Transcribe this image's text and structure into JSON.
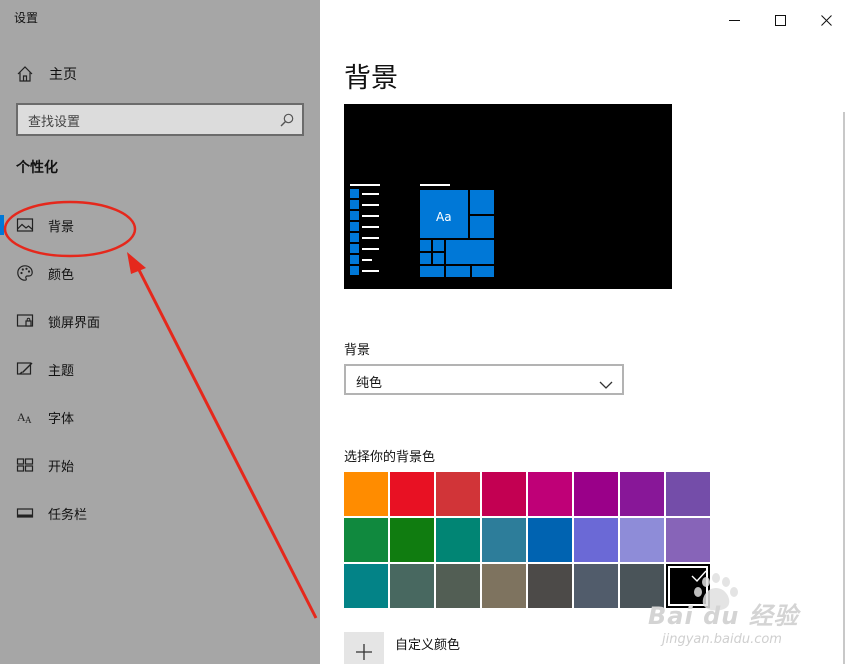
{
  "window": {
    "title": "设置",
    "buttons": [
      "minimize-icon",
      "maximize-icon",
      "close-icon"
    ]
  },
  "sidebar": {
    "home_label": "主页",
    "search_placeholder": "查找设置",
    "section_title": "个性化",
    "items": [
      {
        "label": "背景",
        "icon": "picture-icon",
        "selected": true
      },
      {
        "label": "颜色",
        "icon": "palette-icon",
        "selected": false
      },
      {
        "label": "锁屏界面",
        "icon": "lock-screen-icon",
        "selected": false
      },
      {
        "label": "主题",
        "icon": "theme-icon",
        "selected": false
      },
      {
        "label": "字体",
        "icon": "font-icon",
        "selected": false
      },
      {
        "label": "开始",
        "icon": "start-icon",
        "selected": false
      },
      {
        "label": "任务栏",
        "icon": "taskbar-icon",
        "selected": false
      }
    ]
  },
  "main": {
    "title": "背景",
    "preview_tile_text": "Aa",
    "background_label": "背景",
    "background_value": "纯色",
    "color_label": "选择你的背景色",
    "custom_color_label": "自定义颜色",
    "selected_color": "#000000",
    "swatches": [
      "#ff8c00",
      "#e81123",
      "#d13438",
      "#c30052",
      "#bf0077",
      "#9a0089",
      "#881798",
      "#744da9",
      "#10893e",
      "#107c10",
      "#018574",
      "#2d7d9a",
      "#0063b1",
      "#6b69d6",
      "#8e8cd8",
      "#8764b8",
      "#038387",
      "#486860",
      "#525e54",
      "#7e735f",
      "#4c4a48",
      "#515c6b",
      "#4a5459",
      "#000000"
    ]
  },
  "colors": {
    "accent": "#0078d7",
    "annotation": "#e5281c"
  },
  "watermark": {
    "brand": "Bai du 经验",
    "url": "jingyan.baidu.com"
  }
}
